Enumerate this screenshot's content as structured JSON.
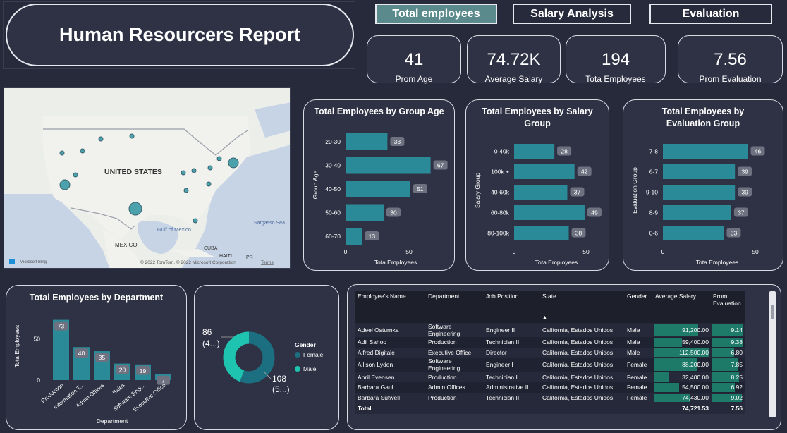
{
  "header": {
    "title": "Human Resourcers Report"
  },
  "tabs": [
    {
      "label": "Total employees",
      "active": true
    },
    {
      "label": "Salary Analysis",
      "active": false
    },
    {
      "label": "Evaluation",
      "active": false
    }
  ],
  "kpis": [
    {
      "value": "41",
      "label": "Prom Age"
    },
    {
      "value": "74.72K",
      "label": "Average Salary"
    },
    {
      "value": "194",
      "label": "Tota Employees"
    },
    {
      "value": "7.56",
      "label": "Prom Evaluation"
    }
  ],
  "map": {
    "country_label": "UNITED STATES",
    "labels": [
      "MEXICO",
      "CUBA",
      "HAITI",
      "PR",
      "Gulf of Mexico",
      "Sargasso Sea"
    ],
    "attribution": "© 2022 TomTom, © 2022 Microsoft Corporation",
    "terms": "Terms",
    "logo": "Microsoft Bing"
  },
  "colors": {
    "bar": "#2a8a97",
    "bar_dark": "#1f6f7c",
    "donut_female": "#1c6f80",
    "donut_male": "#1fc4b0",
    "label_box": "#6e7180",
    "table_bar": "#1d8a72"
  },
  "chart_data": [
    {
      "id": "age",
      "type": "bar",
      "orientation": "horizontal",
      "title": "Total Employees by Group Age",
      "categories": [
        "20-30",
        "30-40",
        "40-50",
        "50-60",
        "60-70"
      ],
      "values": [
        33,
        67,
        51,
        30,
        13
      ],
      "xlabel": "Tota Employees",
      "ylabel": "Group Age",
      "xticks": [
        "0",
        "50"
      ],
      "xlim": [
        0,
        70
      ]
    },
    {
      "id": "salary",
      "type": "bar",
      "orientation": "horizontal",
      "title": "Total Employees by Salary Group",
      "categories": [
        "0-40k",
        "100k +",
        "40-60k",
        "60-80k",
        "80-100k"
      ],
      "values": [
        28,
        42,
        37,
        49,
        38
      ],
      "xlabel": "Tota Employees",
      "ylabel": "Salary Group",
      "xticks": [
        "0",
        "50"
      ],
      "xlim": [
        0,
        50
      ]
    },
    {
      "id": "evaluation",
      "type": "bar",
      "orientation": "horizontal",
      "title": "Total Employees by Evaluation Group",
      "categories": [
        "7-8",
        "6-7",
        "9-10",
        "8-9",
        "0-6"
      ],
      "values": [
        46,
        39,
        39,
        37,
        33
      ],
      "xlabel": "Tota Employees",
      "ylabel": "Evaluation Group",
      "xticks": [
        "0",
        "50"
      ],
      "xlim": [
        0,
        50
      ]
    },
    {
      "id": "department",
      "type": "bar",
      "orientation": "vertical",
      "title": "Total Employees by Department",
      "categories": [
        "Production",
        "Information T...",
        "Admin Offices",
        "Sales",
        "Software Engi...",
        "Executive Office"
      ],
      "values": [
        73,
        40,
        35,
        20,
        19,
        7
      ],
      "xlabel": "Department",
      "ylabel": "Tota Employees",
      "yticks": [
        "0",
        "50"
      ],
      "ylim": [
        0,
        80
      ]
    },
    {
      "id": "gender",
      "type": "pie",
      "donut": true,
      "legend_title": "Gender",
      "series": [
        {
          "name": "Female",
          "value": 108,
          "label": "108",
          "sub": "(5...)"
        },
        {
          "name": "Male",
          "value": 86,
          "label": "86",
          "sub": "(4...)"
        }
      ]
    }
  ],
  "table": {
    "columns": [
      "Employee's Name",
      "Department",
      "Job Position",
      "State",
      "Gender",
      "Average Salary",
      "Prom Evaluation"
    ],
    "rows": [
      [
        "Adeel Osturnka",
        "Software Engineering",
        "Engineer II",
        "California, Estados Unidos",
        "Male",
        "91,200.00",
        "9.14"
      ],
      [
        "Adil Sahoo",
        "Production",
        "Technician II",
        "California, Estados Unidos",
        "Male",
        "59,400.00",
        "9.38"
      ],
      [
        "Alfred Digitale",
        "Executive Office",
        "Director",
        "California, Estados Unidos",
        "Male",
        "112,500.00",
        "6.80"
      ],
      [
        "Allison Lydon",
        "Software Engineering",
        "Engineer I",
        "California, Estados Unidos",
        "Female",
        "88,200.00",
        "7.85"
      ],
      [
        "April Evensen",
        "Production",
        "Technician I",
        "California, Estados Unidos",
        "Female",
        "32,400.00",
        "8.25"
      ],
      [
        "Barbara Gaul",
        "Admin Offices",
        "Administrative II",
        "California, Estados Unidos",
        "Female",
        "54,500.00",
        "6.92"
      ],
      [
        "Barbara Sutwell",
        "Production",
        "Technician II",
        "California, Estados Unidos",
        "Female",
        "74,430.00",
        "9.02"
      ]
    ],
    "salary_fraction": [
      0.81,
      0.53,
      1.0,
      0.78,
      0.29,
      0.48,
      0.66
    ],
    "eval_fraction": [
      0.97,
      1.0,
      0.72,
      0.84,
      0.88,
      0.74,
      0.96
    ],
    "total": {
      "label": "Total",
      "salary": "74,721.53",
      "evaluation": "7.56"
    }
  }
}
